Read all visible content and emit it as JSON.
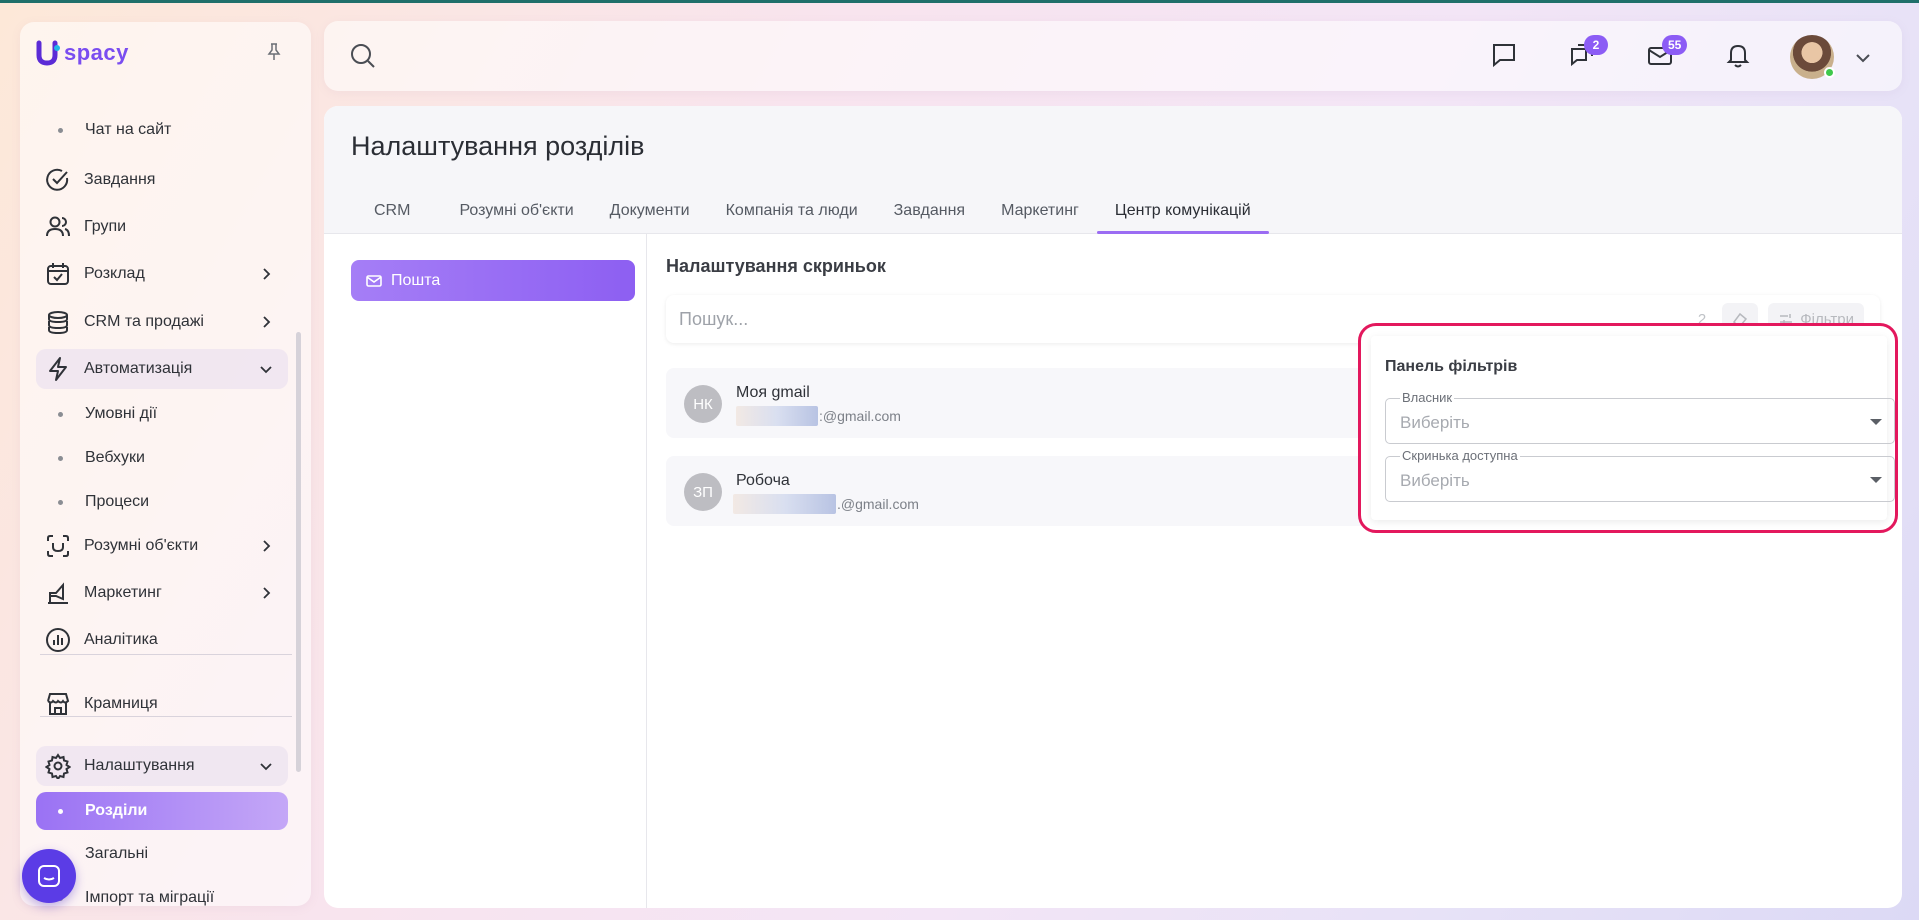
{
  "brand": {
    "name": "spacy"
  },
  "sidebar": {
    "items": [
      {
        "kind": "sub",
        "label": "Чат на сайт"
      },
      {
        "kind": "item",
        "label": "Завдання",
        "icon": "check-circle-icon"
      },
      {
        "kind": "item",
        "label": "Групи",
        "icon": "users-icon"
      },
      {
        "kind": "item",
        "label": "Розклад",
        "icon": "calendar-icon",
        "chevron": "right"
      },
      {
        "kind": "item",
        "label": "CRM та продажі",
        "icon": "coins-icon",
        "chevron": "right"
      },
      {
        "kind": "item",
        "label": "Автоматизація",
        "icon": "lightning-icon",
        "chevron": "down"
      },
      {
        "kind": "sub",
        "label": "Умовні дії"
      },
      {
        "kind": "sub",
        "label": "Вебхуки"
      },
      {
        "kind": "sub",
        "label": "Процеси"
      },
      {
        "kind": "item",
        "label": "Розумні об'єкти",
        "icon": "scan-icon",
        "chevron": "right"
      },
      {
        "kind": "item",
        "label": "Маркетинг",
        "icon": "megaphone-icon",
        "chevron": "right"
      },
      {
        "kind": "item",
        "label": "Аналітика",
        "icon": "chart-icon"
      },
      {
        "kind": "item",
        "label": "Крамниця",
        "icon": "store-icon"
      },
      {
        "kind": "item",
        "label": "Налаштування",
        "icon": "gear-icon",
        "chevron": "down"
      },
      {
        "kind": "sub",
        "label": "Розділи",
        "active": true
      },
      {
        "kind": "sub",
        "label": "Загальні"
      },
      {
        "kind": "sub",
        "label": "Імпорт та міграції"
      }
    ]
  },
  "topbar": {
    "search_icon": "search-icon",
    "chat_icon": "chat-icon",
    "messages_badge": "2",
    "mail_badge": "55",
    "notifications_icon": "bell-icon"
  },
  "page": {
    "title": "Налаштування розділів",
    "tabs": [
      "CRM",
      "Розумні об'єкти",
      "Документи",
      "Компанія та люди",
      "Завдання",
      "Маркетинг",
      "Центр комунікацій"
    ],
    "active_tab": "Центр комунікацій",
    "left_menu": {
      "mail": "Пошта"
    }
  },
  "mailboxes": {
    "section_title": "Налаштування скриньок",
    "search_placeholder": "Пошук...",
    "count": "2",
    "filters_label": "Фільтри",
    "items": [
      {
        "initials": "НК",
        "name": "Моя gmail",
        "email_suffix": ":@gmail.com"
      },
      {
        "initials": "ЗП",
        "name": "Робоча",
        "email_suffix": ".@gmail.com"
      }
    ]
  },
  "filter_panel": {
    "title": "Панель фільтрів",
    "owner_label": "Власник",
    "owner_value": "Виберіть",
    "available_label": "Скринька доступна",
    "available_value": "Виберіть"
  },
  "colors": {
    "accent": "#8c5cf5",
    "highlight_border": "#e3185d",
    "fab": "#5b3ce6"
  }
}
